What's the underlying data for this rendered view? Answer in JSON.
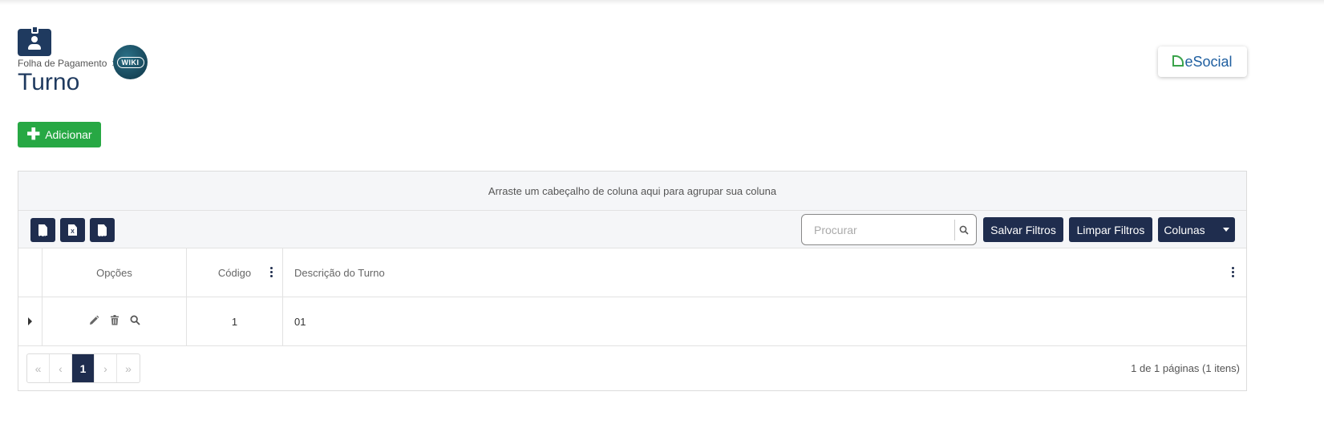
{
  "breadcrumb": {
    "parent": "Folha de Pagamento",
    "separator": ">",
    "wiki": "WIKI"
  },
  "page": {
    "title": "Turno"
  },
  "esocial": {
    "label": "eSocial"
  },
  "actions": {
    "add_label": "Adicionar"
  },
  "grid": {
    "group_panel_text": "Arraste um cabeçalho de coluna aqui para agrupar sua coluna",
    "export": {
      "pdf": "PDF",
      "xls": "X",
      "csv": "CSV"
    },
    "search": {
      "placeholder": "Procurar",
      "value": ""
    },
    "buttons": {
      "save_filters": "Salvar Filtros",
      "clear_filters": "Limpar Filtros",
      "columns": "Colunas"
    },
    "columns": {
      "options": "Opções",
      "code": "Código",
      "description": "Descrição do Turno"
    },
    "rows": [
      {
        "code": "1",
        "description": "01"
      }
    ],
    "pager": {
      "first": "«",
      "prev": "‹",
      "current": "1",
      "next": "›",
      "last": "»",
      "info": "1 de 1 páginas (1 itens)"
    }
  },
  "colors": {
    "primary": "#1f2d4e",
    "success": "#27a844",
    "title": "#1f3a5f"
  },
  "icons": [
    "badge-icon",
    "wiki-icon",
    "esocial-leaf-icon",
    "plus-icon",
    "pdf-file-icon",
    "excel-file-icon",
    "csv-file-icon",
    "search-icon",
    "caret-down-icon",
    "kebab-icon",
    "expand-icon",
    "edit-icon",
    "trash-icon",
    "magnify-icon"
  ]
}
